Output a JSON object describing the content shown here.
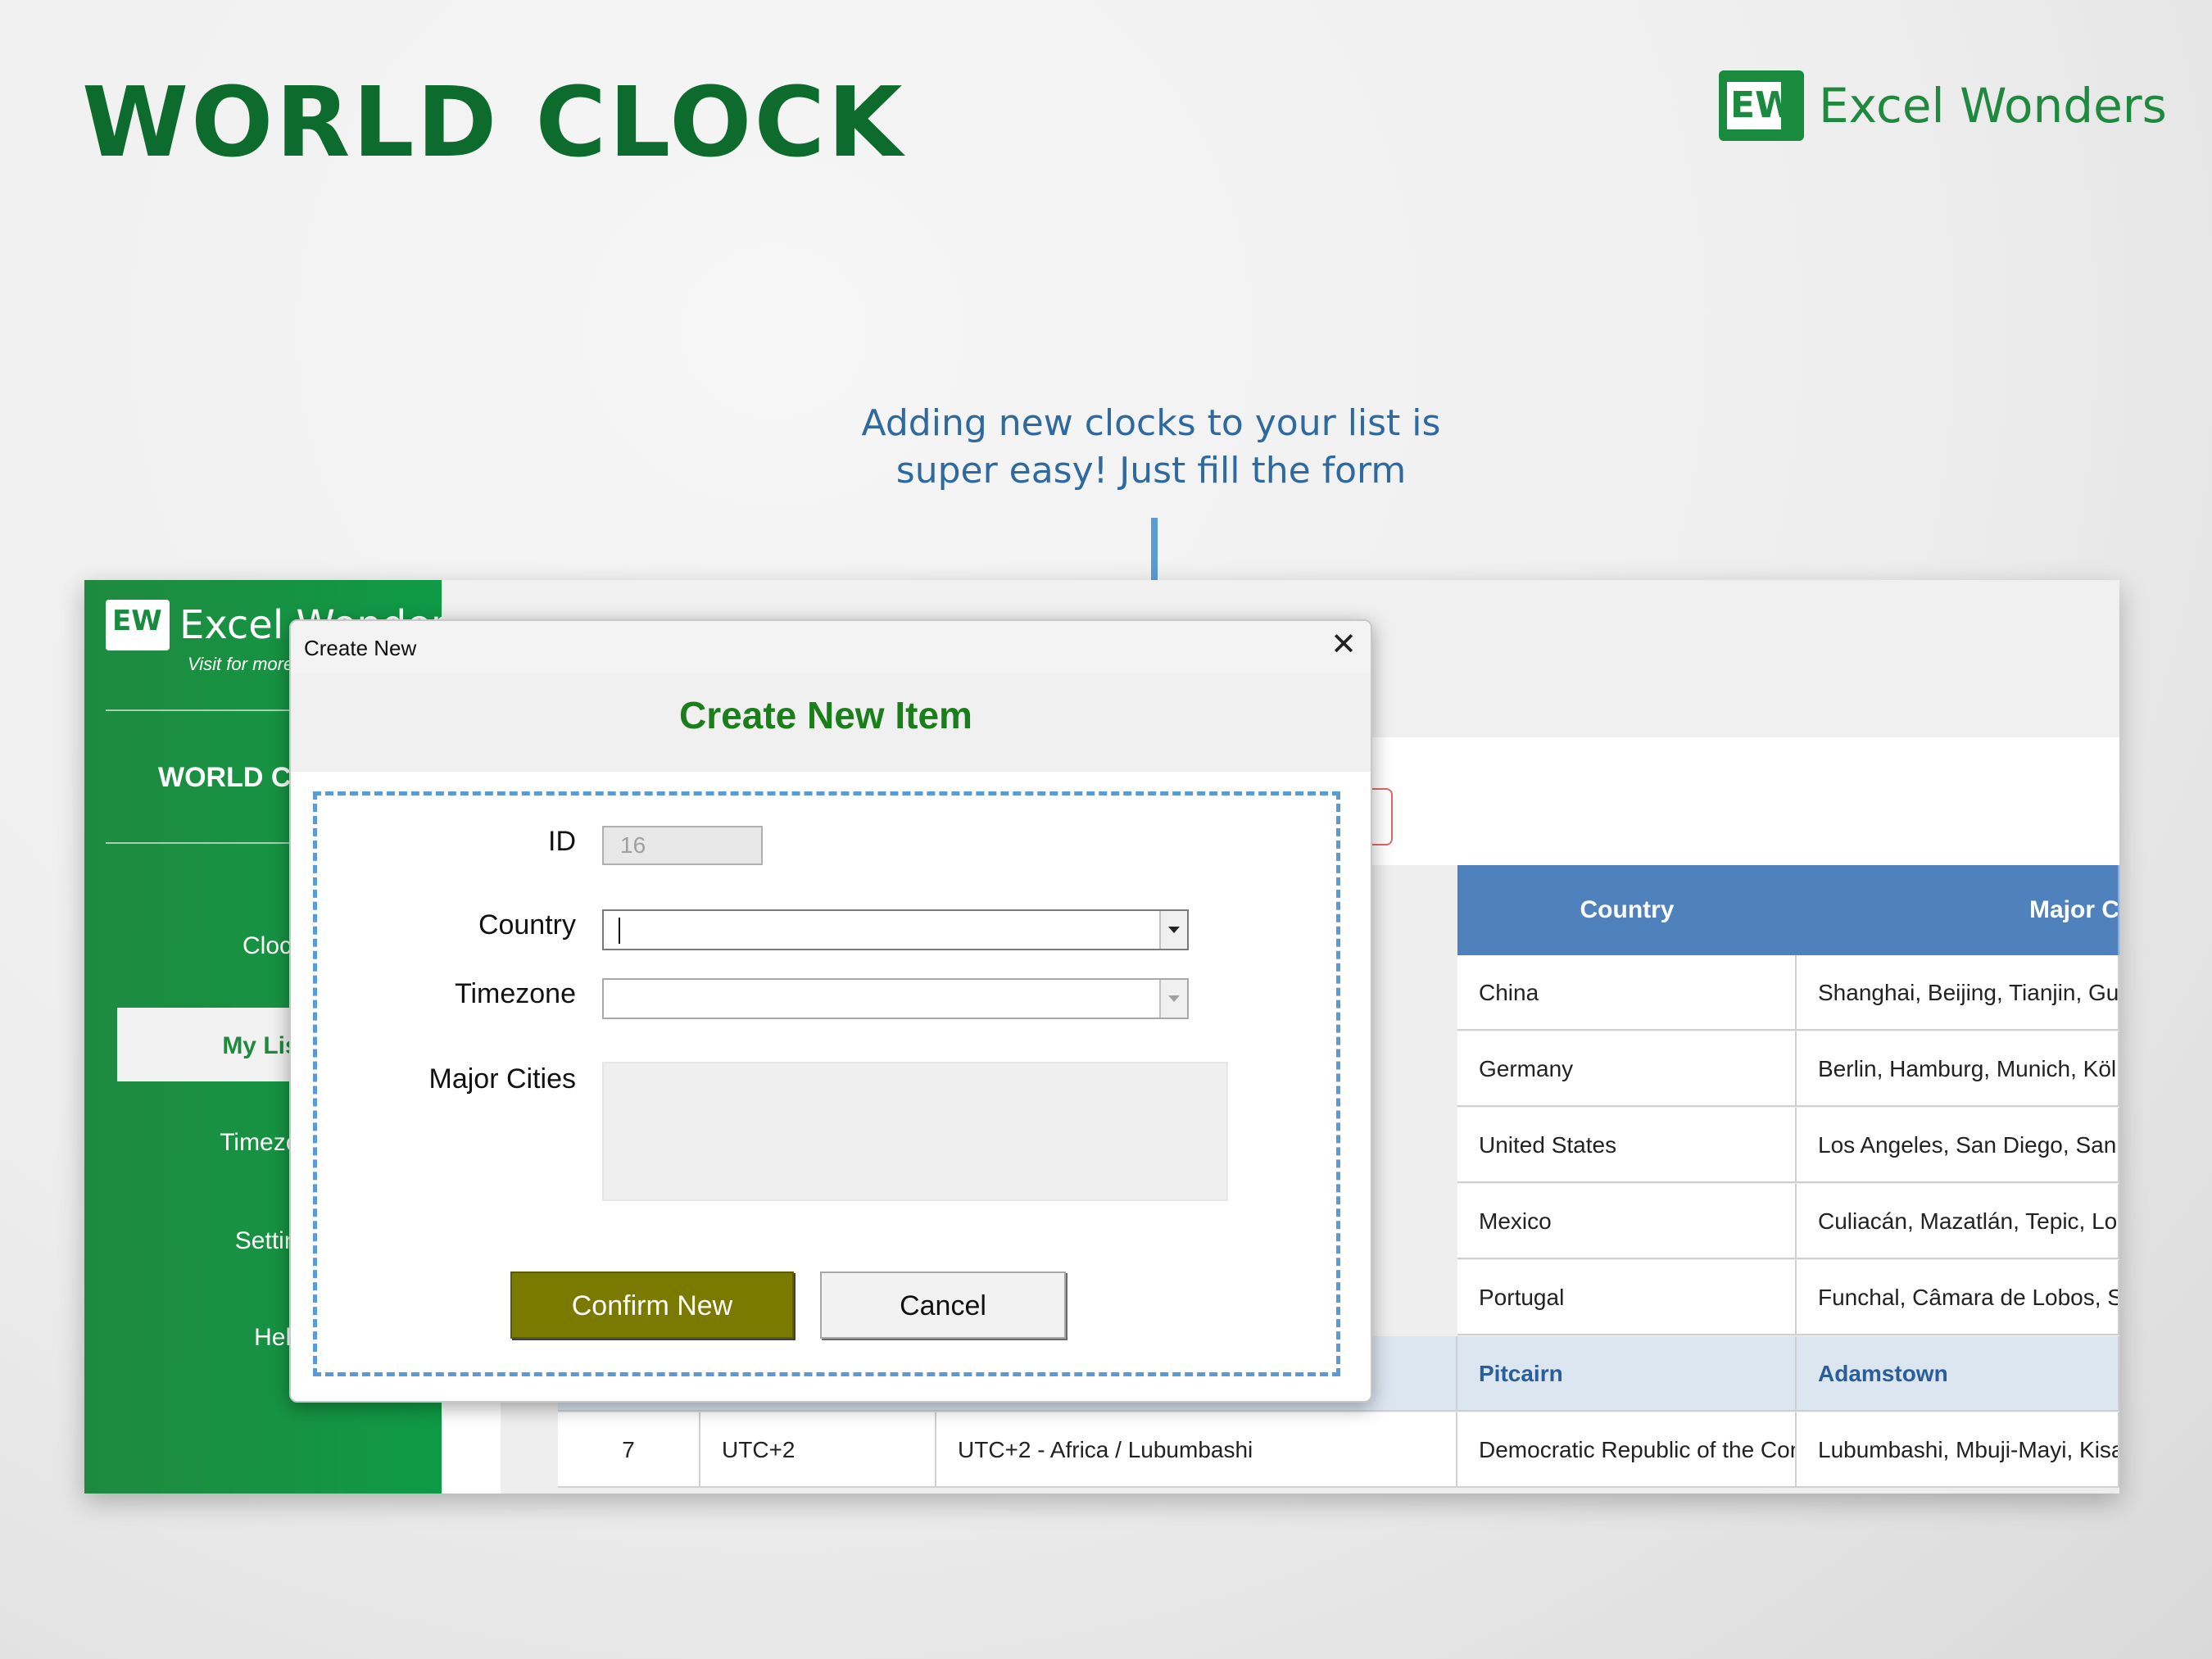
{
  "page": {
    "title": "WORLD CLOCK",
    "brand": "Excel Wonders",
    "brand_logo_text": "EW",
    "callout_line1": "Adding new clocks to your list is",
    "callout_line2": "super easy! Just fill the form"
  },
  "sidebar": {
    "brand": "Excel Wonders",
    "visit": "Visit for more",
    "title": "WORLD CLOCK",
    "items": [
      "Clocks",
      "My List",
      "Timezones",
      "Settings",
      "Help"
    ],
    "active_item": "My List"
  },
  "table": {
    "headers": [
      "Country",
      "Major Cities in Timezone"
    ],
    "rows": [
      {
        "country": "China",
        "cities": "Shanghai, Beijing, Tianjin, Guangzhou,"
      },
      {
        "country": "Germany",
        "cities": "Berlin, Hamburg, Munich, Köln, Frankfu"
      },
      {
        "country": "United States",
        "cities": "Los Angeles, San Diego, San Jose, Sa"
      },
      {
        "country": "Mexico",
        "cities": "Culiacán, Mazatlán, Tepic, Los Mochis,"
      },
      {
        "country": "Portugal",
        "cities": "Funchal, Câmara de Lobos, São Martin"
      },
      {
        "country": "Pitcairn",
        "cities": "Adamstown"
      }
    ],
    "last_row": {
      "id": "7",
      "offset": "UTC+2",
      "timezone": "UTC+2 - Africa / Lubumbashi",
      "country": "Democratic Republic of the Con",
      "cities": "Lubumbashi, Mbuji-Mayi, Kisangani, Ka"
    }
  },
  "dialog": {
    "window_title": "Create New",
    "close_glyph": "✕",
    "heading": "Create New Item",
    "id_label": "ID",
    "id_value": "16",
    "country_label": "Country",
    "country_value": "",
    "timezone_label": "Timezone",
    "timezone_value": "",
    "cities_label": "Major Cities",
    "cities_value": "",
    "confirm_label": "Confirm New",
    "cancel_label": "Cancel"
  },
  "colors": {
    "brand_green": "#0d6b2e",
    "callout_blue": "#2e6aa0",
    "header_blue": "#4f81bd",
    "confirm_olive": "#7a7a00",
    "heading_green": "#1a7f1a"
  }
}
